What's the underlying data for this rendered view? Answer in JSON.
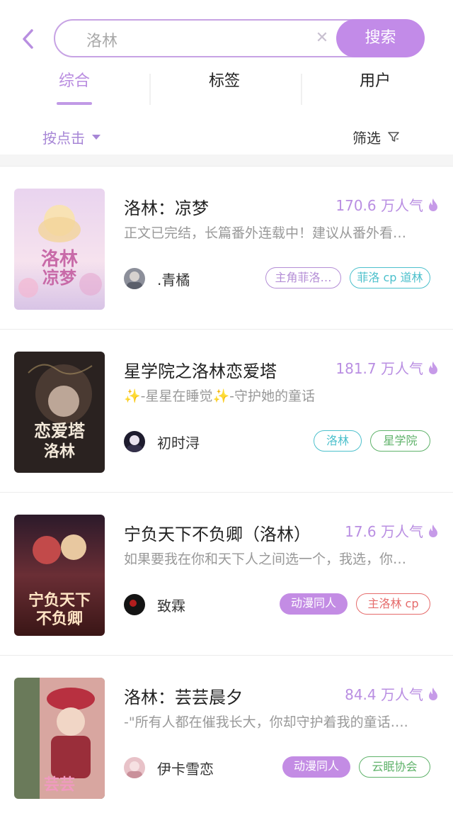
{
  "header": {
    "search_value": "洛林",
    "search_button": "搜索",
    "clear_icon": "close-icon",
    "accent": "#c28be8"
  },
  "tabs": [
    {
      "label": "综合",
      "active": true
    },
    {
      "label": "标签",
      "active": false
    },
    {
      "label": "用户",
      "active": false
    }
  ],
  "filters": {
    "sort_label": "按点击",
    "filter_label": "筛选"
  },
  "books": [
    {
      "title": "洛林：凉梦",
      "popularity": "170.6 万人气",
      "description": "正文已完结，长篇番外连载中！建议从番外看…",
      "author": ".青橘",
      "tags": [
        {
          "label": "主角菲洛…",
          "color": "#b48ed6",
          "filled": false
        },
        {
          "label": "菲洛 cp 道林",
          "color": "#4cc0cc",
          "filled": false
        }
      ]
    },
    {
      "title": "星学院之洛林恋爱塔",
      "popularity": "181.7 万人气",
      "description": "✨-星星在睡觉✨-守护她的童话",
      "author": "初时浔",
      "tags": [
        {
          "label": "洛林",
          "color": "#4cc0cc",
          "filled": false
        },
        {
          "label": "星学院",
          "color": "#5fb26a",
          "filled": false
        }
      ]
    },
    {
      "title": "宁负天下不负卿（洛林）",
      "popularity": "17.6 万人气",
      "description": "如果要我在你和天下人之间选一个，我选，你…",
      "author": "致霖",
      "tags": [
        {
          "label": "动漫同人",
          "color": "#c38ce4",
          "filled": true
        },
        {
          "label": "主洛林 cp",
          "color": "#e56b6b",
          "filled": false
        }
      ]
    },
    {
      "title": "洛林：芸芸晨夕",
      "popularity": "84.4 万人气",
      "description": "-\"所有人都在催我长大，你却守护着我的童话….",
      "author": "伊卡雪恋",
      "tags": [
        {
          "label": "动漫同人",
          "color": "#c38ce4",
          "filled": true
        },
        {
          "label": "云眠协会",
          "color": "#5fb26a",
          "filled": false
        }
      ]
    }
  ]
}
